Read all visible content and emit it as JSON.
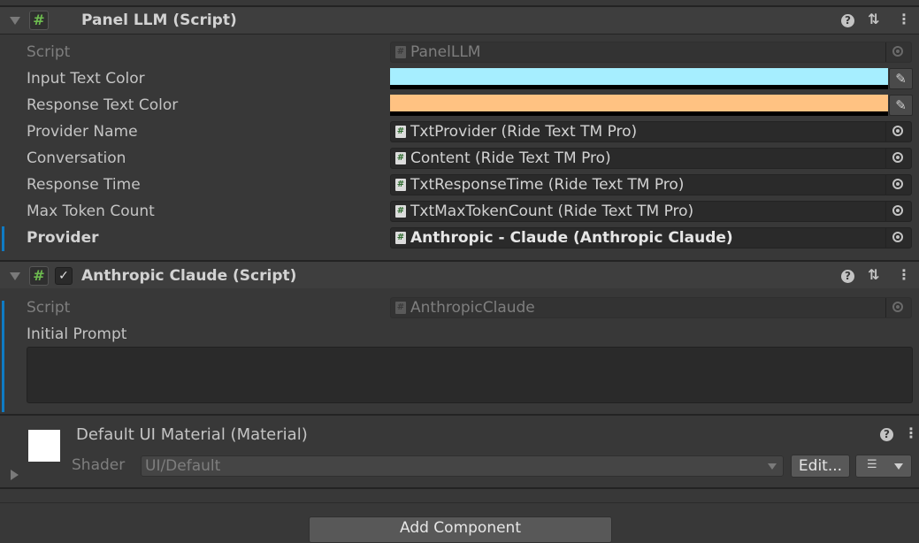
{
  "panel": {
    "title": "Panel LLM (Script)",
    "props": [
      {
        "label": "Script",
        "value": "PanelLLM"
      },
      {
        "label": "Input Text Color",
        "color": "#a6eeff"
      },
      {
        "label": "Response Text Color",
        "color": "#ffc282"
      },
      {
        "label": "Provider Name",
        "value": "TxtProvider (Ride Text TM Pro)"
      },
      {
        "label": "Conversation",
        "value": "Content (Ride Text TM Pro)"
      },
      {
        "label": "Response Time",
        "value": "TxtResponseTime (Ride Text TM Pro)"
      },
      {
        "label": "Max Token Count",
        "value": "TxtMaxTokenCount (Ride Text TM Pro)"
      },
      {
        "label": "Provider",
        "value": "Anthropic - Claude (Anthropic Claude)"
      }
    ]
  },
  "anthropic": {
    "title": "Anthropic Claude (Script)",
    "enabled_check": "✓",
    "script_label": "Script",
    "script_value": "AnthropicClaude",
    "prompt_label": "Initial Prompt",
    "prompt_value": ""
  },
  "material": {
    "title": "Default UI Material (Material)",
    "shader_label": "Shader",
    "shader_value": "UI/Default",
    "edit_label": "Edit..."
  },
  "add_component_label": "Add Component",
  "icons": {
    "foldout": "triangle-down-icon",
    "script": "script-hash-icon",
    "help": "help-icon",
    "presets": "presets-icon",
    "menu": "kebab-menu-icon",
    "object_picker": "object-picker-icon",
    "eyedropper": "eyedropper-icon"
  }
}
